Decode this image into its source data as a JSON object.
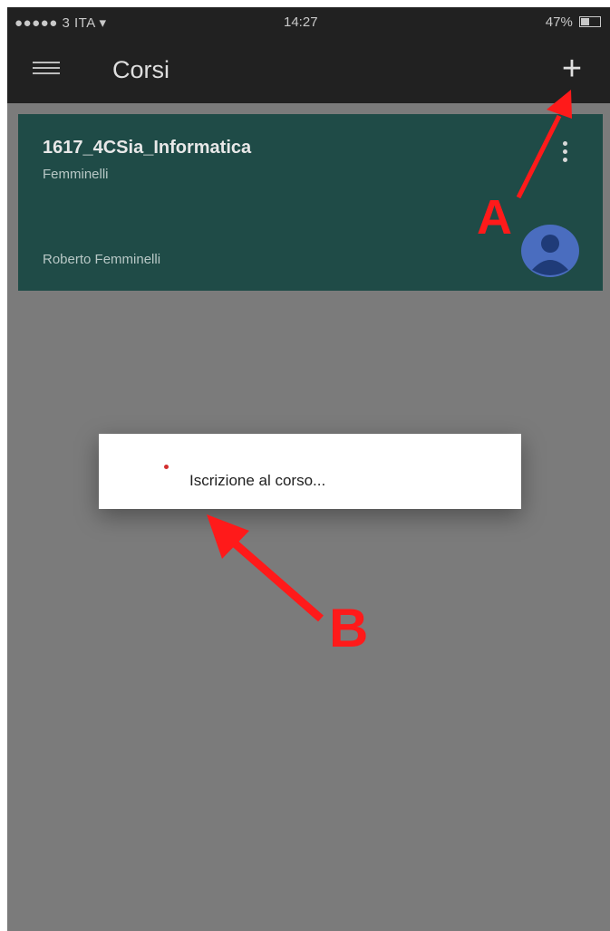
{
  "status_bar": {
    "carrier": "●●●●● 3 ITA",
    "wifi_icon": "wifi-icon",
    "time": "14:27",
    "battery": "47%"
  },
  "toolbar": {
    "menu_icon": "hamburger-menu-icon",
    "title": "Corsi",
    "add_label": "+"
  },
  "course_card": {
    "title": "1617_4CSia_Informatica",
    "subtitle": "Femminelli",
    "owner": "Roberto Femminelli",
    "menu_icon": "more-vertical-icon",
    "avatar_icon": "person-avatar-icon"
  },
  "dialog": {
    "message": "Iscrizione al corso..."
  },
  "annotations": {
    "label_a": "A",
    "label_b": "B",
    "color": "#ff1a1a"
  },
  "colors": {
    "toolbar": "#212121",
    "background": "#7b7b7b",
    "card": "#1f4b47",
    "avatar": "#4a6dbf"
  }
}
